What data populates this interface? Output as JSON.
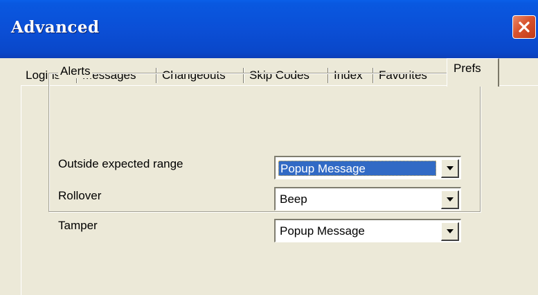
{
  "window": {
    "title": "Advanced",
    "close_icon": "close-icon"
  },
  "tabs": [
    {
      "label": "Logins",
      "active": false
    },
    {
      "label": "Messages",
      "active": false
    },
    {
      "label": "Changeouts",
      "active": false
    },
    {
      "label": "Skip Codes",
      "active": false
    },
    {
      "label": "Index",
      "active": false
    },
    {
      "label": "Favorites",
      "active": false
    },
    {
      "label": "Prefs",
      "active": true
    }
  ],
  "alerts": {
    "group_label": "Alerts",
    "rows": [
      {
        "label": "Outside expected range",
        "value": "Popup Message",
        "focused": true
      },
      {
        "label": "Rollover",
        "value": "Beep",
        "focused": false
      },
      {
        "label": "Tamper",
        "value": "Popup Message",
        "focused": false
      }
    ]
  },
  "colors": {
    "titlebar": "#0b4fd6",
    "close_button": "#d8532d",
    "selection": "#316ac5",
    "dialog_background": "#ece9d8"
  }
}
